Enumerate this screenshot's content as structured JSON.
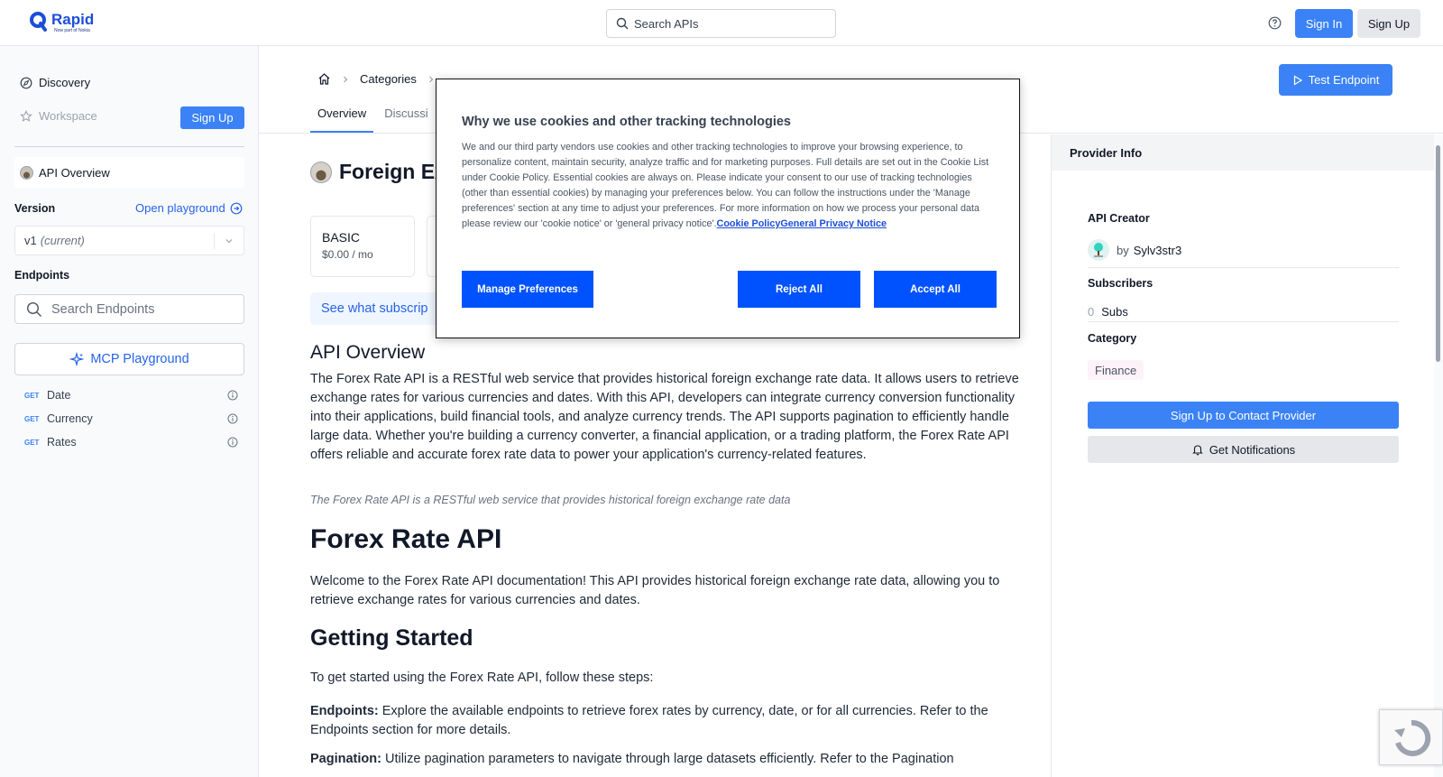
{
  "header": {
    "logo": "Rapid",
    "logo_sub": "Now part of Nokia",
    "search_placeholder": "Search APIs",
    "sign_in": "Sign In",
    "sign_up": "Sign Up"
  },
  "sidebar": {
    "discovery": "Discovery",
    "workspace": "Workspace",
    "signup": "Sign Up",
    "api_overview": "API Overview",
    "version_label": "Version",
    "open_playground": "Open playground",
    "version_value": "v1",
    "version_current": "(current)",
    "endpoints_label": "Endpoints",
    "search_endpoints": "Search Endpoints",
    "mcp": "MCP Playground",
    "endpoints": [
      {
        "method": "GET",
        "name": "Date"
      },
      {
        "method": "GET",
        "name": "Currency"
      },
      {
        "method": "GET",
        "name": "Rates"
      }
    ]
  },
  "main": {
    "breadcrumb_categories": "Categories",
    "tabs": [
      "Overview",
      "Discussi"
    ],
    "test_endpoint": "Test Endpoint",
    "api_title": "Foreign Ex",
    "plans": [
      {
        "name": "BASIC",
        "price": "$0.00 / mo"
      }
    ],
    "subs_link": "See what subscrip",
    "overview_heading": "API Overview",
    "overview_text": "The Forex Rate API is a RESTful web service that provides historical foreign exchange rate data. It allows users to retrieve exchange rates for various currencies and dates. With this API, developers can integrate currency conversion functionality into their applications, build financial tools, and analyze currency trends. The API supports pagination to efficiently handle large data. Whether you're building a currency converter, a financial application, or a trading platform, the Forex Rate API offers reliable and accurate forex rate data to power your application's currency-related features.",
    "caption": "The Forex Rate API is a RESTful web service that provides historical foreign exchange rate data",
    "doc_title": "Forex Rate API",
    "welcome": "Welcome to the Forex Rate API documentation! This API provides historical foreign exchange rate data, allowing you to retrieve exchange rates for various currencies and dates.",
    "getting_started": "Getting Started",
    "steps_intro": "To get started using the Forex Rate API, follow these steps:",
    "endpoints_label": "Endpoints:",
    "endpoints_text": " Explore the available endpoints to retrieve forex rates by currency, date, or for all currencies. Refer to the Endpoints section for more details.",
    "pagination_label": "Pagination:",
    "pagination_text": " Utilize pagination parameters to navigate through large datasets efficiently. Refer to the Pagination"
  },
  "provider": {
    "header": "Provider Info",
    "creator_label": "API Creator",
    "by": "by",
    "creator": "Sylv3str3",
    "subscribers_label": "Subscribers",
    "subs_count": "0",
    "subs_unit": "Subs",
    "category_label": "Category",
    "category": "Finance",
    "contact": "Sign Up to Contact Provider",
    "notifications": "Get Notifications"
  },
  "cookie": {
    "title": "Why we use cookies and other tracking technologies",
    "body": "We and our third party vendors use cookies and other tracking technologies to improve your browsing experience, to personalize content, maintain security, analyze traffic and for marketing purposes. Full details are set out in the Cookie List under Cookie Policy. Essential cookies are always on. Please indicate your consent to our use of tracking technologies (other than essential cookies) by managing your preferences below. You can follow the instructions under the 'Manage preferences' section at any time to adjust your preferences. For more information on how we process your personal data please review our 'cookie notice' or 'general privacy notice'.",
    "link_cookie": "Cookie Policy",
    "link_privacy": "General Privacy Notice",
    "manage": "Manage Preferences",
    "reject": "Reject All",
    "accept": "Accept All"
  },
  "colors": {
    "accent": "#3b82f6",
    "cookie_button": "#0052ff"
  }
}
